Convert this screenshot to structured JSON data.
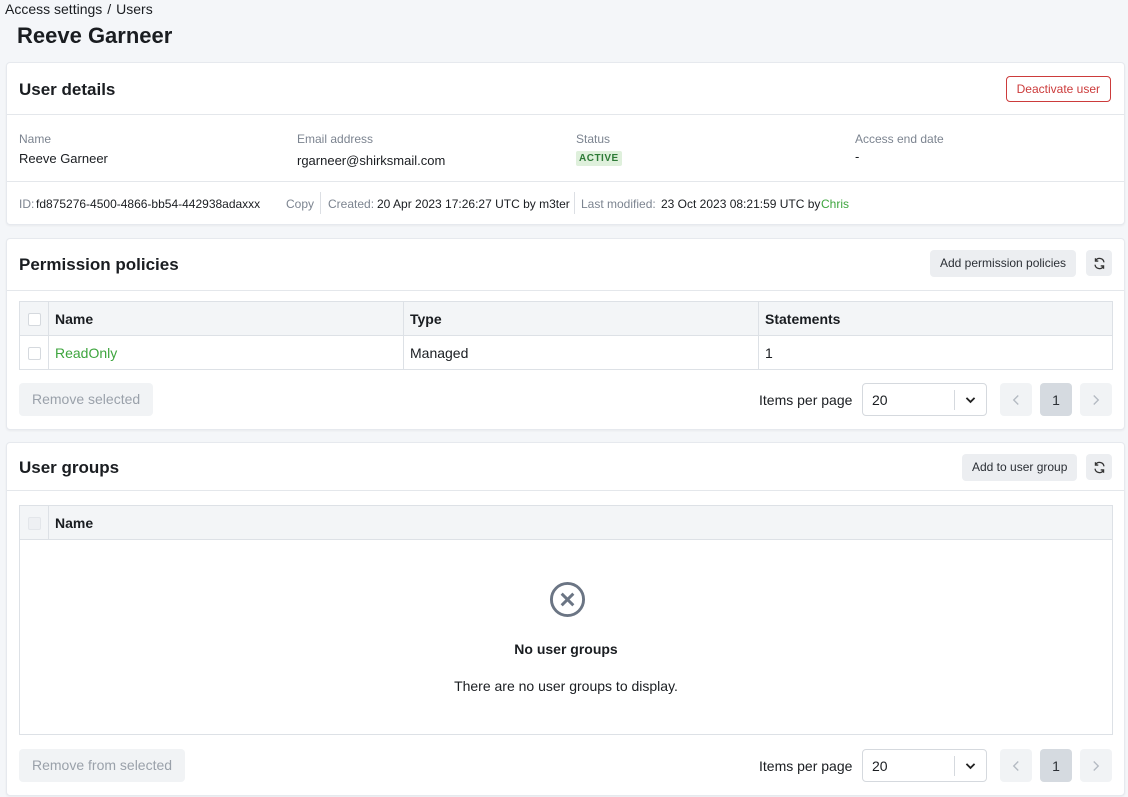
{
  "breadcrumb": {
    "parent": "Access settings",
    "separator": "/",
    "current": "Users"
  },
  "page_title": "Reeve Garneer",
  "user_details": {
    "title": "User details",
    "deactivate_label": "Deactivate user",
    "fields": {
      "name_label": "Name",
      "name_value": "Reeve Garneer",
      "email_label": "Email address",
      "email_value": "rgarneer@shirksmail.com",
      "status_label": "Status",
      "status_value": "ACTIVE",
      "end_label": "Access end date",
      "end_value": "-"
    },
    "meta": {
      "id_label": "ID:",
      "id_value": "fd875276-4500-4866-bb54-442938adaxxx",
      "copy_label": "Copy",
      "created_label": "Created:",
      "created_value": "20 Apr 2023 17:26:27 UTC by m3ter",
      "modified_label": "Last modified:",
      "modified_value": "23 Oct 2023 08:21:59 UTC by",
      "modified_by": "Chris"
    }
  },
  "permission_policies": {
    "title": "Permission policies",
    "add_label": "Add permission policies",
    "columns": [
      "Name",
      "Type",
      "Statements"
    ],
    "rows": [
      {
        "name": "ReadOnly",
        "type": "Managed",
        "statements": "1"
      }
    ],
    "remove_label": "Remove selected",
    "items_per_page_label": "Items per page",
    "items_per_page": "20",
    "current_page": "1"
  },
  "user_groups": {
    "title": "User groups",
    "add_label": "Add to user group",
    "columns": [
      "Name"
    ],
    "empty_title": "No user groups",
    "empty_text": "There are no user groups to display.",
    "remove_label": "Remove from selected",
    "items_per_page_label": "Items per page",
    "items_per_page": "20",
    "current_page": "1"
  },
  "icons": {
    "refresh": "refresh-icon",
    "chevron": "chevron-down-icon",
    "empty": "x-circle-icon"
  },
  "colors": {
    "accent_green": "#3ea53e",
    "danger": "#cc3b3b",
    "active_badge_bg": "#dff0dc"
  }
}
